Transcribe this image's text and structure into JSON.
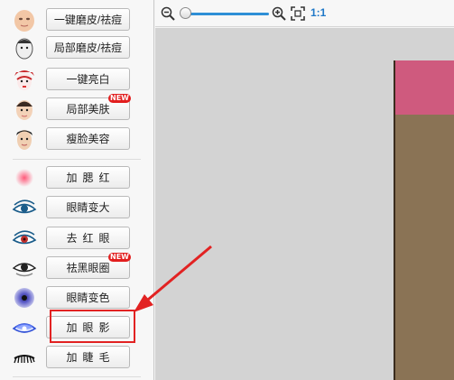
{
  "sidebar": {
    "items": [
      {
        "label": "一键磨皮/祛痘",
        "icon": "face-smooth-icon",
        "spaced": false,
        "new": false
      },
      {
        "label": "局部磨皮/祛痘",
        "icon": "face-sketch-icon",
        "spaced": false,
        "new": false
      },
      {
        "label": "一键亮白",
        "icon": "opera-face-icon",
        "spaced": false,
        "new": false
      },
      {
        "label": "局部美肤",
        "icon": "skin-face-icon",
        "spaced": false,
        "new": true
      },
      {
        "label": "瘦脸美容",
        "icon": "slim-face-icon",
        "spaced": false,
        "new": false
      },
      {
        "label": "加腮红",
        "icon": "blush-icon",
        "spaced": true,
        "new": false
      },
      {
        "label": "眼睛变大",
        "icon": "eye-enlarge-icon",
        "spaced": false,
        "new": false
      },
      {
        "label": "去红眼",
        "icon": "red-eye-icon",
        "spaced": true,
        "new": false
      },
      {
        "label": "祛黑眼圈",
        "icon": "dark-circle-eye-icon",
        "spaced": false,
        "new": true
      },
      {
        "label": "眼睛变色",
        "icon": "eye-color-icon",
        "spaced": false,
        "new": false
      },
      {
        "label": "加眼影",
        "icon": "eye-shadow-icon",
        "spaced": true,
        "new": false
      },
      {
        "label": "加睫毛",
        "icon": "eyelash-icon",
        "spaced": true,
        "new": false
      }
    ],
    "new_badge": "NEW"
  },
  "toolbar": {
    "zoom_ratio_label": "1:1"
  },
  "colors": {
    "accent": "#1f78c8",
    "highlight": "#e22222",
    "badge": "#e21e1e"
  }
}
